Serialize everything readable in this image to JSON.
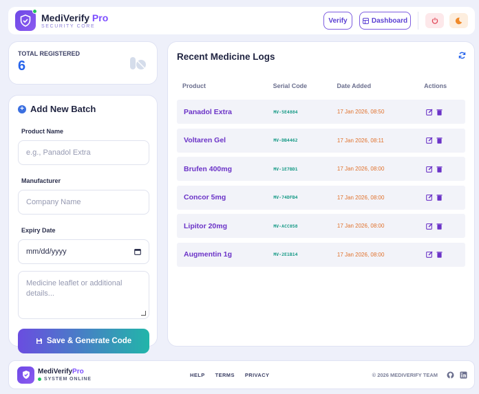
{
  "header": {
    "brand_name": "MediVerify",
    "brand_pro": "Pro",
    "brand_sub": "SECURITY CORE",
    "verify_label": "Verify",
    "dashboard_label": "Dashboard"
  },
  "stats": {
    "label": "TOTAL REGISTERED",
    "value": "6"
  },
  "form": {
    "title": "Add New Batch",
    "product_label": "Product Name",
    "product_placeholder": "e.g., Panadol Extra",
    "manufacturer_label": "Manufacturer",
    "manufacturer_placeholder": "Company Name",
    "expiry_label": "Expiry Date",
    "expiry_value": "mm/dd/yyyy",
    "notes_placeholder": "Medicine leaflet or additional details...",
    "save_label": "Save & Generate Code"
  },
  "logs": {
    "title": "Recent Medicine Logs",
    "columns": [
      "Product",
      "Serial Code",
      "Date Added",
      "Actions"
    ],
    "rows": [
      {
        "product": "Panadol Extra",
        "serial": "MV-5E4884",
        "date": "17 Jan 2026, 08:50"
      },
      {
        "product": "Voltaren Gel",
        "serial": "MV-DB4462",
        "date": "17 Jan 2026, 08:11"
      },
      {
        "product": "Brufen 400mg",
        "serial": "MV-1E7BD1",
        "date": "17 Jan 2026, 08:00"
      },
      {
        "product": "Concor 5mg",
        "serial": "MV-74DFB4",
        "date": "17 Jan 2026, 08:00"
      },
      {
        "product": "Lipitor 20mg",
        "serial": "MV-ACC058",
        "date": "17 Jan 2026, 08:00"
      },
      {
        "product": "Augmentin 1g",
        "serial": "MV-2E1B14",
        "date": "17 Jan 2026, 08:00"
      }
    ]
  },
  "footer": {
    "brand_name": "MediVerify",
    "brand_pro": "Pro",
    "status": "SYSTEM ONLINE",
    "links": [
      "HELP",
      "TERMS",
      "PRIVACY"
    ],
    "copyright": "© 2026 MEDIVERIFY TEAM"
  },
  "colors": {
    "accent": "#7c4dff",
    "serial": "#169a86",
    "date": "#e0702a",
    "online": "#22c55e"
  }
}
